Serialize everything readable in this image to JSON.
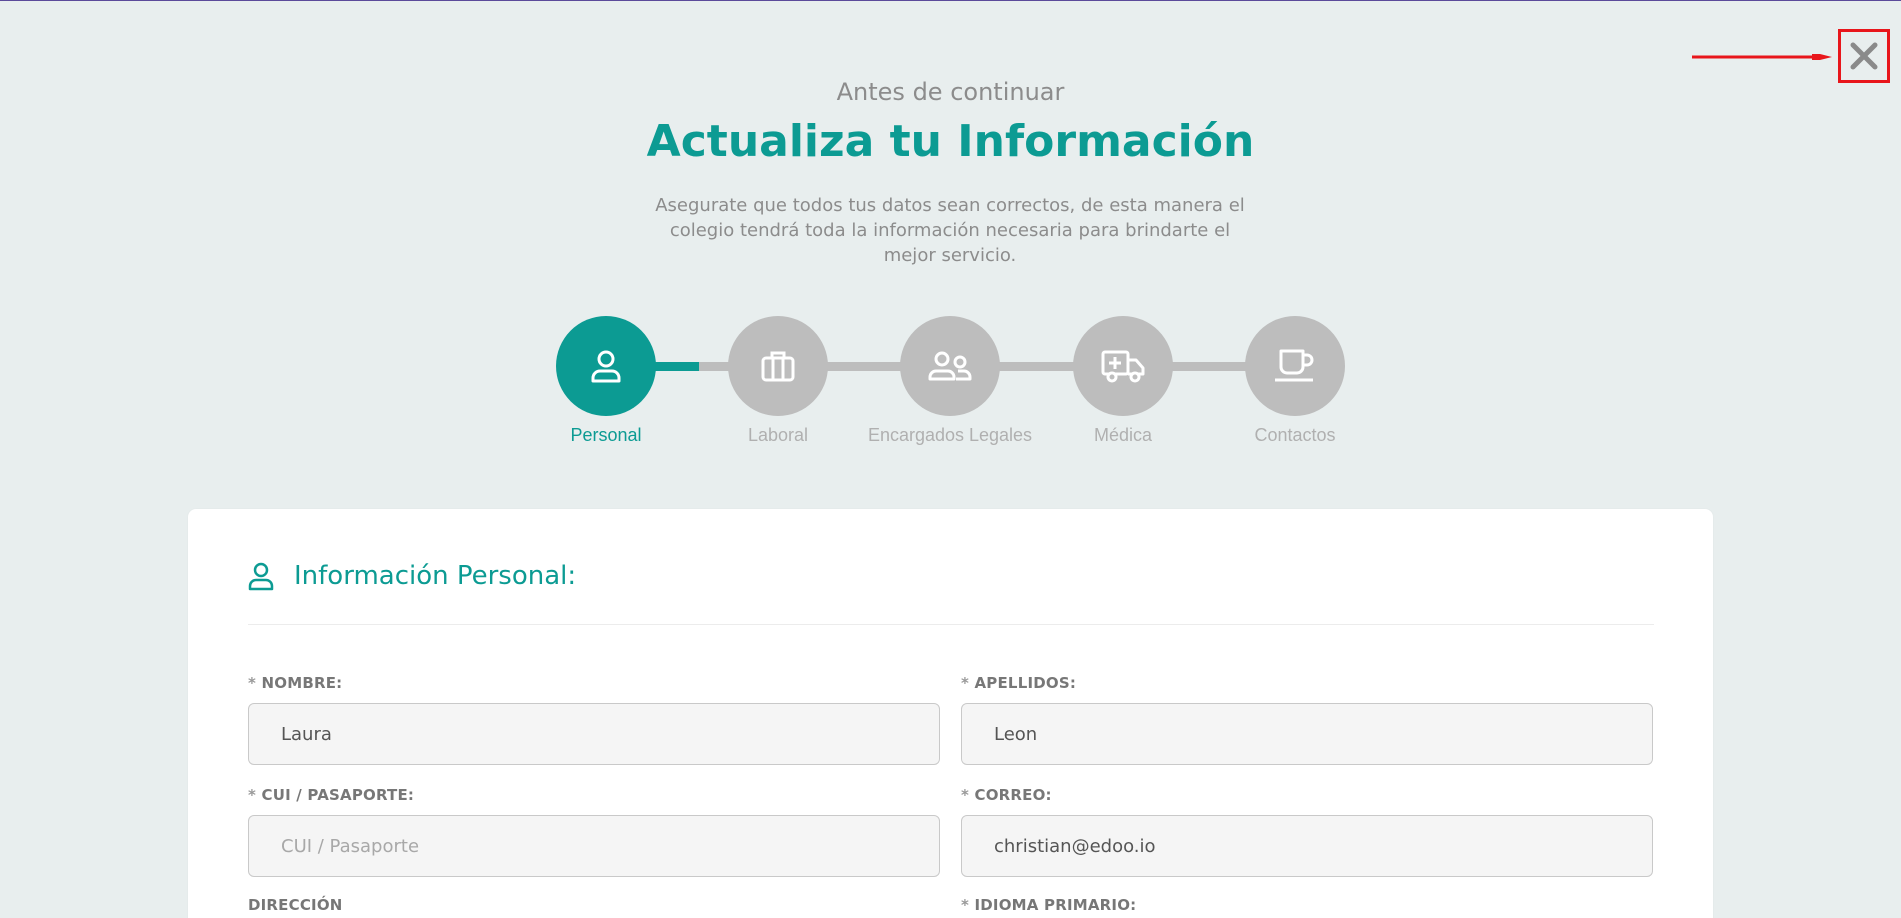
{
  "header": {
    "pre_title": "Antes de continuar",
    "title": "Actualiza tu Información",
    "subtitle": "Asegurate que todos tus datos sean correctos, de esta manera el colegio tendrá toda la información necesaria para brindarte el mejor servicio."
  },
  "close_button": {
    "icon": "close-icon",
    "color": "#8a8a8a",
    "highlight_color": "#e8161b"
  },
  "stepper": {
    "progress_fraction_first_segment": 0.35,
    "steps": [
      {
        "label": "Personal",
        "icon": "user-icon",
        "active": true
      },
      {
        "label": "Laboral",
        "icon": "briefcase-icon",
        "active": false
      },
      {
        "label": "Encargados Legales",
        "icon": "users-icon",
        "active": false
      },
      {
        "label": "Médica",
        "icon": "ambulance-icon",
        "active": false
      },
      {
        "label": "Contactos",
        "icon": "coffee-icon",
        "active": false
      }
    ]
  },
  "section": {
    "title": "Información Personal:",
    "icon": "user-icon"
  },
  "fields": {
    "nombre": {
      "label": "NOMBRE:",
      "required": "*",
      "value": "Laura"
    },
    "apellidos": {
      "label": "APELLIDOS:",
      "required": "*",
      "value": "Leon"
    },
    "cui": {
      "label": "CUI / PASAPORTE:",
      "required": "*",
      "value": "",
      "placeholder": "CUI / Pasaporte"
    },
    "correo": {
      "label": "CORREO:",
      "required": "*",
      "value": "christian@edoo.io"
    },
    "direccion": {
      "label": "DIRECCIÓN"
    },
    "idioma": {
      "label": "IDIOMA PRIMARIO:",
      "required": "*"
    }
  },
  "colors": {
    "accent": "#0c9b93",
    "inactive": "#bdbdbd",
    "background": "#e8eeee"
  }
}
